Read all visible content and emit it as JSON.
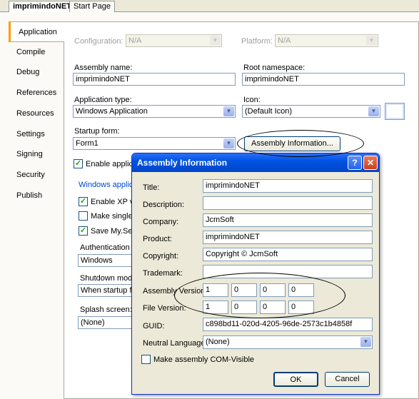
{
  "doc_tabs": [
    {
      "label": "imprimindoNET",
      "active": true
    },
    {
      "label": "Start Page",
      "active": false
    }
  ],
  "side_tabs": [
    "Application",
    "Compile",
    "Debug",
    "References",
    "Resources",
    "Settings",
    "Signing",
    "Security",
    "Publish"
  ],
  "app_page": {
    "configuration_label": "Configuration:",
    "configuration_value": "N/A",
    "platform_label": "Platform:",
    "platform_value": "N/A",
    "assembly_name_label": "Assembly name:",
    "assembly_name_value": "imprimindoNET",
    "root_namespace_label": "Root namespace:",
    "root_namespace_value": "imprimindoNET",
    "application_type_label": "Application type:",
    "application_type_value": "Windows Application",
    "icon_label": "Icon:",
    "icon_value": "(Default Icon)",
    "startup_form_label": "Startup form:",
    "startup_form_value": "Form1",
    "assembly_info_button": "Assembly Information...",
    "enable_application_label": "Enable applicat",
    "windows_app_link": "Windows applicat",
    "enable_xp_label": "Enable XP vis",
    "make_single_label": "Make single in",
    "save_my_label": "Save My.Sett",
    "authentication_label": "Authentication m",
    "authentication_value": "Windows",
    "shutdown_label": "Shutdown mode:",
    "shutdown_value": "When startup fo",
    "splash_label": "Splash screen:",
    "splash_value": "(None)"
  },
  "dialog": {
    "title": "Assembly Information",
    "help_glyph": "?",
    "close_glyph": "✕",
    "title_label": "Title:",
    "title_value": "imprimindoNET",
    "description_label": "Description:",
    "description_value": "",
    "company_label": "Company:",
    "company_value": "JcmSoft",
    "product_label": "Product:",
    "product_value": "imprimindoNET",
    "copyright_label": "Copyright:",
    "copyright_value": "Copyright © JcmSoft",
    "trademark_label": "Trademark:",
    "trademark_value": "",
    "assembly_version_label": "Assembly Version:",
    "assembly_version": [
      "1",
      "0",
      "0",
      "0"
    ],
    "file_version_label": "File Version:",
    "file_version": [
      "1",
      "0",
      "0",
      "0"
    ],
    "guid_label": "GUID:",
    "guid_value": "c898bd11-020d-4205-96de-2573c1b4858f",
    "neutral_language_label": "Neutral Language:",
    "neutral_language_value": "(None)",
    "com_visible_label": "Make assembly COM-Visible",
    "ok_label": "OK",
    "cancel_label": "Cancel"
  },
  "icons": {
    "dropdown": "chevron-down-icon",
    "checkmark": "checkmark-icon",
    "help": "help-icon",
    "close": "close-icon"
  },
  "colors": {
    "active_tab_accent": "#ff9d00",
    "title_bar": "#0054e3",
    "close_button": "#c9401d",
    "link": "#0046d5"
  }
}
